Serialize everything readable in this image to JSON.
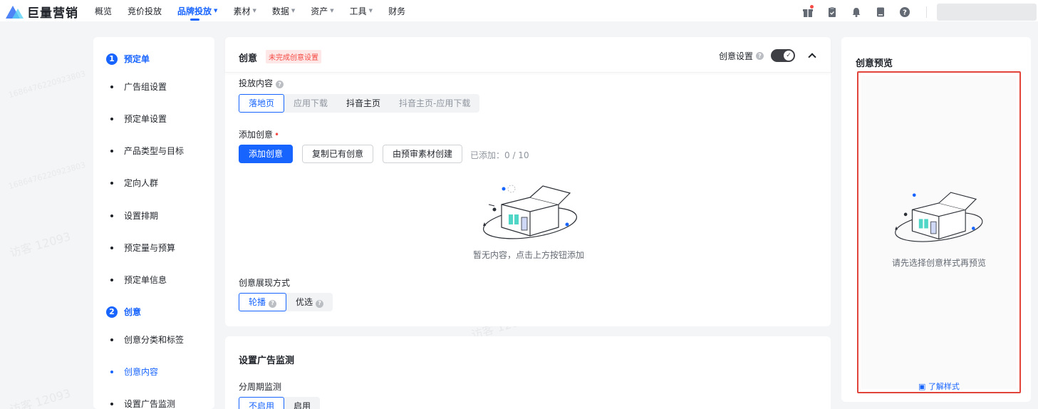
{
  "header": {
    "logo_text": "巨量营销",
    "nav": [
      {
        "label": "概览",
        "caret": false
      },
      {
        "label": "竞价投放",
        "caret": false
      },
      {
        "label": "品牌投放",
        "caret": true,
        "active": true
      },
      {
        "label": "素材",
        "caret": true
      },
      {
        "label": "数据",
        "caret": true
      },
      {
        "label": "资产",
        "caret": true
      },
      {
        "label": "工具",
        "caret": true
      },
      {
        "label": "财务",
        "caret": false
      }
    ]
  },
  "steps": {
    "step1": {
      "num": "1",
      "label": "预定单"
    },
    "step1_items": [
      "广告组设置",
      "预定单设置",
      "产品类型与目标",
      "定向人群",
      "设置排期",
      "预定量与预算",
      "预定单信息"
    ],
    "step2": {
      "num": "2",
      "label": "创意"
    },
    "step2_items": [
      "创意分类和标签",
      "创意内容",
      "设置广告监测"
    ]
  },
  "creative": {
    "title": "创意",
    "warning_tag": "未完成创意设置",
    "setting_label": "创意设置",
    "content_label": "投放内容",
    "content_options": [
      "落地页",
      "应用下载",
      "抖音主页",
      "抖音主页-应用下载"
    ],
    "add_label": "添加创意",
    "add_button": "添加创意",
    "copy_button": "复制已有创意",
    "prereview_button": "由预审素材创建",
    "added_count": "已添加：0 / 10",
    "empty_text": "暂无内容，点击上方按钮添加",
    "display_label": "创意展现方式",
    "display_options": [
      "轮播",
      "优选"
    ]
  },
  "monitor": {
    "title": "设置广告监测",
    "period_label": "分周期监测",
    "period_options": [
      "不启用",
      "启用"
    ]
  },
  "preview": {
    "title": "创意预览",
    "hint": "请先选择创意样式再预览",
    "link": "了解样式"
  },
  "watermark": {
    "visitor": "访客 12093",
    "id": "1686476220923803"
  },
  "colors": {
    "accent": "#1764ff",
    "warning": "#f54a45",
    "highlight_frame": "#e0443b"
  }
}
